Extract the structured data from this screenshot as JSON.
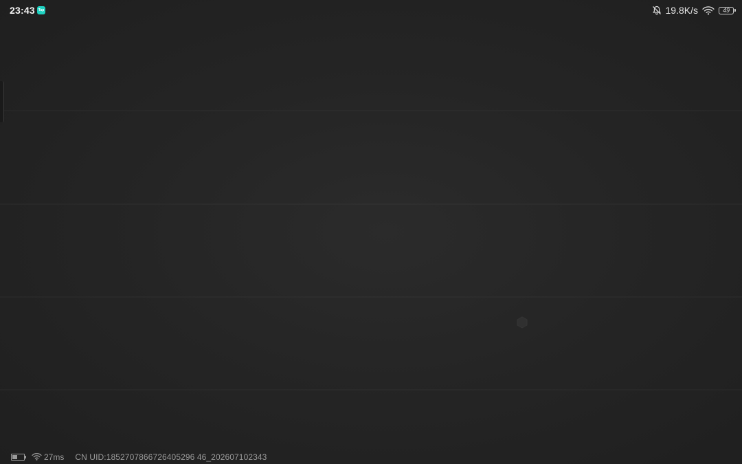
{
  "status_bar": {
    "time": "23:43",
    "notification_app_icon": "taptap-app-icon",
    "notification_app_label": "Tap",
    "mute_icon": "bell-off-icon",
    "net_speed": "19.8K/s",
    "wifi_icon": "wifi-icon",
    "battery_level": "49",
    "accent_color": "#1fd1c1"
  },
  "game_overlay": {
    "battery_icon": "battery-icon",
    "battery_fill_fraction": 0.45,
    "wifi_icon": "wifi-icon",
    "ping": "27ms",
    "uid_text": "CN UID:1852707866726405296 46_202607102343"
  },
  "loading_icon": "hexagon-icon"
}
